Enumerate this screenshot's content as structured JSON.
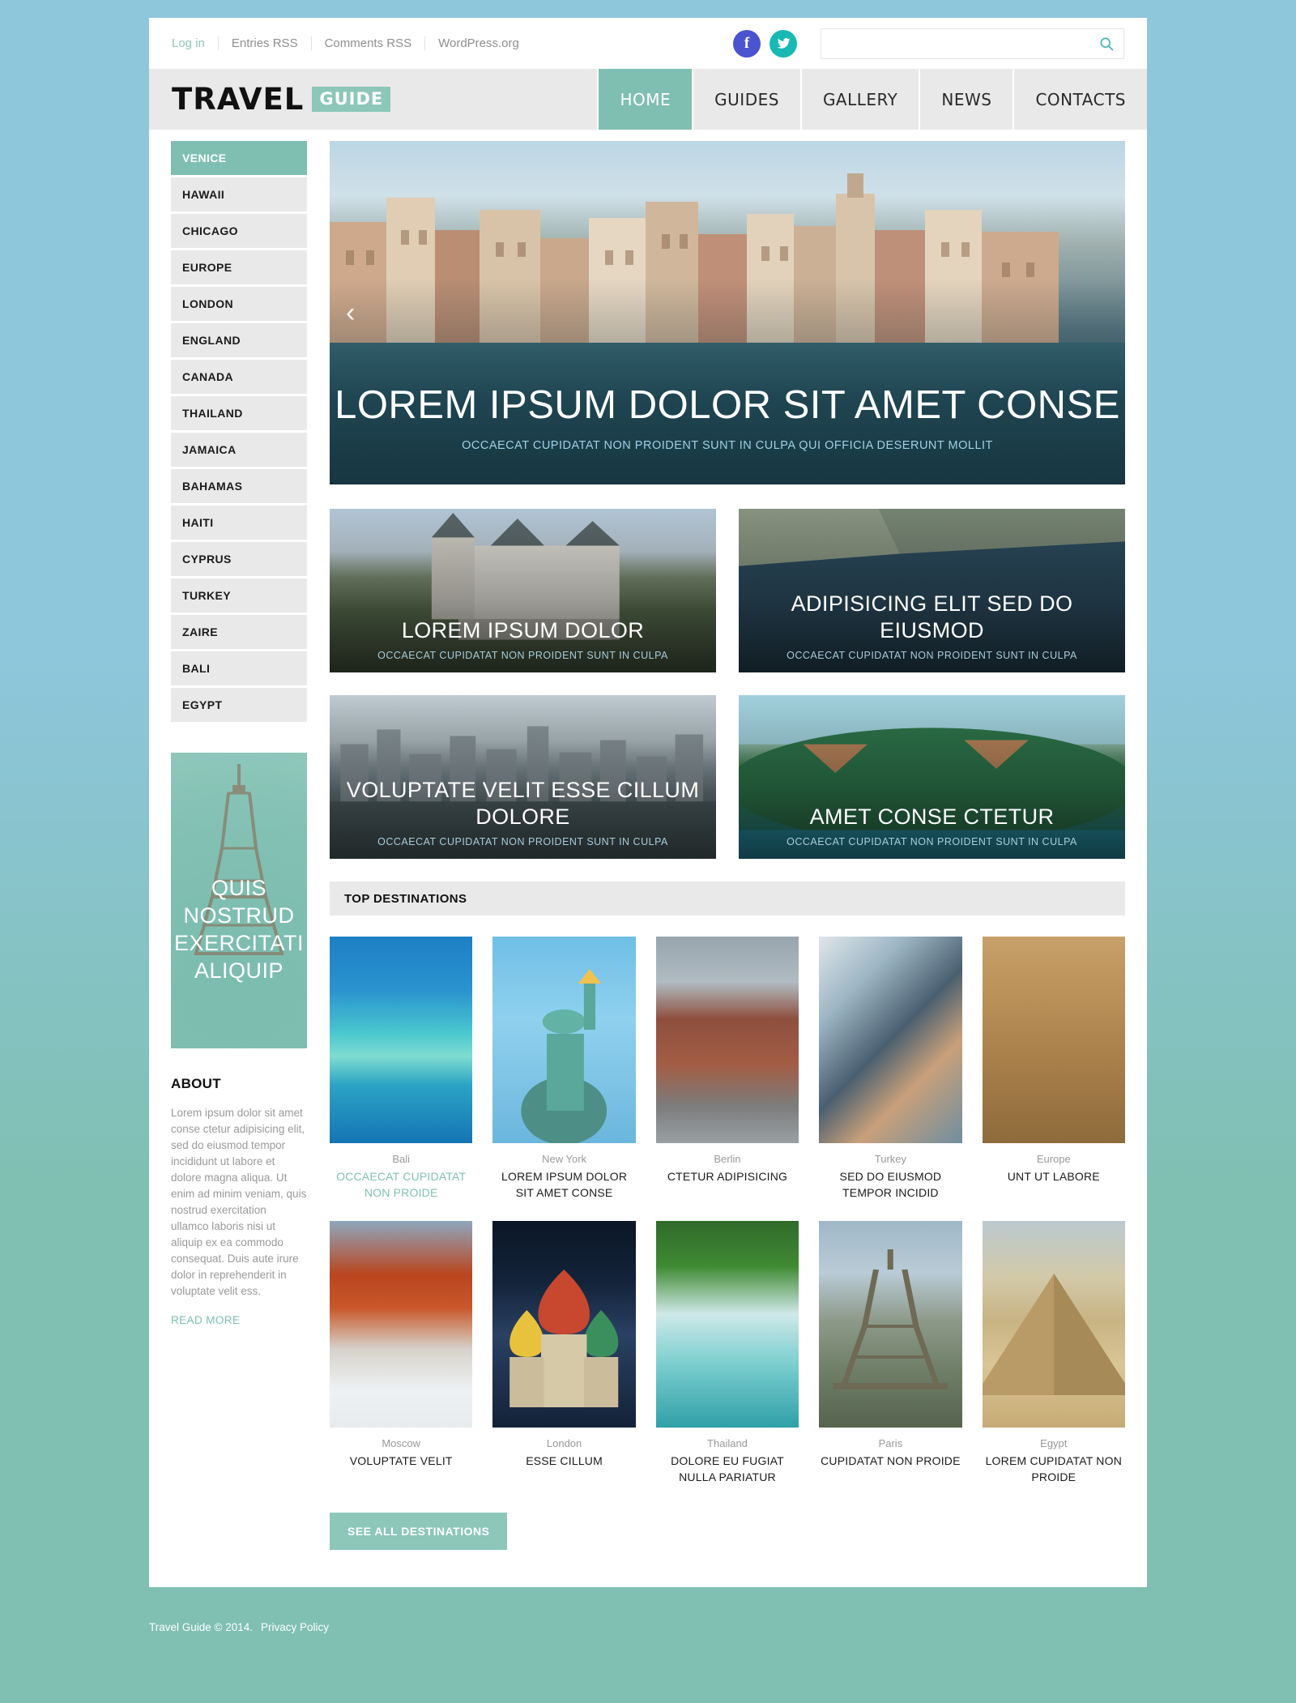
{
  "topbar": {
    "links": [
      "Log in",
      "Entries RSS",
      "Comments RSS",
      "WordPress.org"
    ],
    "social": [
      "facebook-icon",
      "twitter-icon"
    ],
    "search_placeholder": "",
    "search_value": ""
  },
  "header": {
    "logo_main": "TRAVEL",
    "logo_badge": "GUIDE",
    "nav": [
      {
        "label": "HOME",
        "active": true
      },
      {
        "label": "GUIDES",
        "active": false
      },
      {
        "label": "GALLERY",
        "active": false
      },
      {
        "label": "NEWS",
        "active": false
      },
      {
        "label": "CONTACTS",
        "active": false
      }
    ]
  },
  "sidebar": {
    "categories": [
      {
        "label": "VENICE",
        "active": true
      },
      {
        "label": "HAWAII",
        "active": false
      },
      {
        "label": "CHICAGO",
        "active": false
      },
      {
        "label": "EUROPE",
        "active": false
      },
      {
        "label": "LONDON",
        "active": false
      },
      {
        "label": "ENGLAND",
        "active": false
      },
      {
        "label": "CANADA",
        "active": false
      },
      {
        "label": "THAILAND",
        "active": false
      },
      {
        "label": "JAMAICA",
        "active": false
      },
      {
        "label": "BAHAMAS",
        "active": false
      },
      {
        "label": "HAITI",
        "active": false
      },
      {
        "label": "CYPRUS",
        "active": false
      },
      {
        "label": "TURKEY",
        "active": false
      },
      {
        "label": "ZAIRE",
        "active": false
      },
      {
        "label": "BALI",
        "active": false
      },
      {
        "label": "EGYPT",
        "active": false
      }
    ],
    "promo_text": "QUIS NOSTRUD EXERCITATI ALIQUIP",
    "about_heading": "ABOUT",
    "about_text": "Lorem ipsum dolor sit amet conse ctetur adipisicing elit, sed do eiusmod tempor incididunt ut labore et dolore magna aliqua. Ut enim ad minim veniam, quis nostrud exercitation ullamco laboris nisi ut aliquip ex ea commodo consequat. Duis aute irure dolor in reprehenderit in voluptate velit ess.",
    "read_more": "READ MORE"
  },
  "slider": {
    "title": "LOREM IPSUM DOLOR SIT AMET CONSE",
    "subtitle": "OCCAECAT CUPIDATAT NON PROIDENT SUNT IN CULPA QUI OFFICIA DESERUNT MOLLIT",
    "prev_icon": "chevron-left-icon"
  },
  "tiles": [
    {
      "title": "LOREM IPSUM DOLOR",
      "subtitle": "OCCAECAT CUPIDATAT NON PROIDENT SUNT IN CULPA",
      "art": "t-chateau"
    },
    {
      "title": "ADIPISICING ELIT SED DO EIUSMOD",
      "subtitle": "OCCAECAT CUPIDATAT NON PROIDENT SUNT IN CULPA",
      "art": "t-coast"
    },
    {
      "title": "VOLUPTATE VELIT ESSE CILLUM DOLORE",
      "subtitle": "OCCAECAT CUPIDATAT NON PROIDENT SUNT IN CULPA",
      "art": "t-city"
    },
    {
      "title": "AMET CONSE CTETUR",
      "subtitle": "OCCAECAT CUPIDATAT NON PROIDENT SUNT IN CULPA",
      "art": "t-island"
    }
  ],
  "destinations": {
    "section_title": "TOP DESTINATIONS",
    "items": [
      {
        "city": "Bali",
        "title": "OCCAECAT CUPIDATAT NON PROIDE",
        "accent": true,
        "art": "th-bali"
      },
      {
        "city": "New York",
        "title": "LOREM IPSUM DOLOR SIT AMET CONSE",
        "accent": false,
        "art": "th-ny"
      },
      {
        "city": "Berlin",
        "title": "CTETUR ADIPISICING",
        "accent": false,
        "art": "th-berlin"
      },
      {
        "city": "Turkey",
        "title": "SED DO EIUSMOD TEMPOR INCIDID",
        "accent": false,
        "art": "th-turkey"
      },
      {
        "city": "Europe",
        "title": "UNT UT LABORE",
        "accent": false,
        "art": "th-europe"
      },
      {
        "city": "Moscow",
        "title": "VOLUPTATE VELIT",
        "accent": false,
        "art": "th-moscow"
      },
      {
        "city": "London",
        "title": "ESSE CILLUM",
        "accent": false,
        "art": "th-london"
      },
      {
        "city": "Thailand",
        "title": "DOLORE EU FUGIAT NULLA PARIATUR",
        "accent": false,
        "art": "th-thai"
      },
      {
        "city": "Paris",
        "title": "CUPIDATAT NON PROIDE",
        "accent": false,
        "art": "th-paris"
      },
      {
        "city": "Egypt",
        "title": "LOREM  CUPIDATAT NON PROIDE",
        "accent": false,
        "art": "th-egypt"
      }
    ],
    "see_all_label": "SEE ALL DESTINATIONS"
  },
  "footer": {
    "copyright": "Travel Guide © 2014.",
    "privacy": "Privacy Policy"
  },
  "colors": {
    "accent": "#7fbfb1",
    "accent_light": "#8cc7b9",
    "facebook": "#4a54cf",
    "twitter": "#18b9b3",
    "page_top": "#8ec6dc",
    "page_bottom": "#7fc0b2"
  }
}
